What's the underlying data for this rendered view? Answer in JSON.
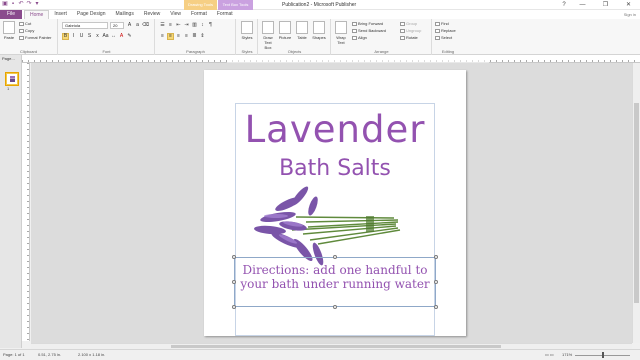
{
  "titlebar": {
    "window_title": "Publication2 - Microsoft Publisher",
    "context_tabs": [
      "Drawing Tools",
      "Text Box Tools"
    ],
    "controls": [
      "?",
      "—",
      "❐",
      "✕"
    ]
  },
  "tabs": {
    "file": "File",
    "items": [
      "Home",
      "Insert",
      "Page Design",
      "Mailings",
      "Review",
      "View",
      "Format",
      "Format"
    ],
    "active": "Home",
    "signin": "Sign in"
  },
  "ribbon": {
    "clipboard": {
      "paste": "Paste",
      "cut": "Cut",
      "copy": "Copy",
      "format_painter": "Format Painter",
      "label": "Clipboard"
    },
    "font": {
      "family": "Gabriola",
      "size": "20",
      "label": "Font",
      "bold": "B",
      "italic": "I",
      "underline": "U"
    },
    "paragraph": {
      "label": "Paragraph"
    },
    "styles": {
      "button": "Styles",
      "label": "Styles"
    },
    "objects": {
      "draw_text_box": "Draw Text Box",
      "picture": "Picture",
      "table": "Table",
      "shapes": "Shapes",
      "label": "Objects"
    },
    "arrange": {
      "wrap_text": "Wrap Text",
      "bring_forward": "Bring Forward",
      "send_backward": "Send Backward",
      "align": "Align",
      "group": "Group",
      "ungroup": "Ungroup",
      "rotate": "Rotate",
      "label": "Arrange"
    },
    "editing": {
      "find": "Find",
      "replace": "Replace",
      "select": "Select",
      "label": "Editing"
    }
  },
  "pages_panel": {
    "header": "Page...",
    "thumb_number": "1"
  },
  "document": {
    "title": "Lavender",
    "subtitle": "Bath Salts",
    "directions": "Directions: add one handful to your bath under running water"
  },
  "status": {
    "page": "Page: 1 of 1",
    "position": "0.51, 2.75 in.",
    "size": "2.100 x 1.18 in.",
    "zoom": "171%"
  },
  "colors": {
    "accent": "#8a4b8d",
    "text_purple": "#9352b0"
  }
}
